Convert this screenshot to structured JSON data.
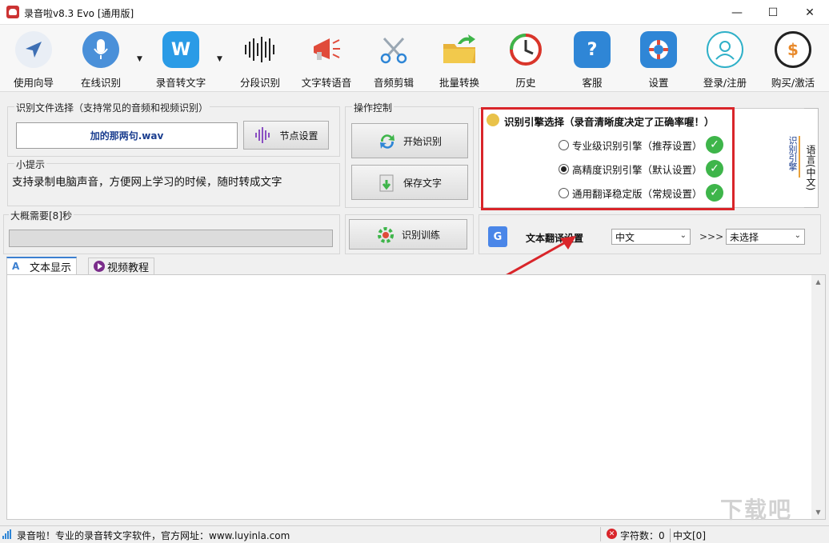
{
  "window": {
    "title": "录音啦v8.3 Evo [通用版]",
    "minimize": "—",
    "maximize": "☐",
    "close": "✕"
  },
  "toolbar": {
    "items": [
      {
        "label": "使用向导",
        "icon": "navigate-icon",
        "color": "#3d6fb4"
      },
      {
        "label": "在线识别",
        "icon": "microphone-icon",
        "color": "#4a90d9"
      },
      {
        "label": "录音转文字",
        "icon": "w-app-icon",
        "color": "#2a9be6"
      },
      {
        "label": "分段识别",
        "icon": "waveform-icon",
        "color": "#222222"
      },
      {
        "label": "文字转语音",
        "icon": "megaphone-icon",
        "color": "#e04b3a"
      },
      {
        "label": "音频剪辑",
        "icon": "scissors-icon",
        "color": "#9aa7b3"
      },
      {
        "label": "批量转换",
        "icon": "folder-icon",
        "color": "#e8b33a"
      },
      {
        "label": "历史",
        "icon": "clock-icon",
        "color": "#d9352a"
      },
      {
        "label": "客服",
        "icon": "help-icon",
        "color": "#2f86d6"
      },
      {
        "label": "设置",
        "icon": "lifebuoy-icon",
        "color": "#2f86d6"
      },
      {
        "label": "登录/注册",
        "icon": "user-icon",
        "color": "#2fb0c8"
      },
      {
        "label": "购买/激活",
        "icon": "coin-icon",
        "color": "#222222"
      }
    ]
  },
  "file_section": {
    "title": "识别文件选择（支持常见的音频和视频识别）",
    "file_name": "加的那两句.wav",
    "node_button": "节点设置"
  },
  "tip_section": {
    "title": "小提示",
    "text": "支持录制电脑声音，方便网上学习的时候，随时转成文字"
  },
  "progress_section": {
    "title": "大概需要[8]秒",
    "value": 0
  },
  "control_section": {
    "title": "操作控制",
    "start_button": "开始识别",
    "save_button": "保存文字",
    "train_button": "识别训练"
  },
  "engine_section": {
    "title": "识别引擎选择（录音清晰度决定了正确率喔！）",
    "options": [
      {
        "label": "专业级识别引擎（推荐设置）",
        "selected": false
      },
      {
        "label": "高精度识别引擎（默认设置）",
        "selected": true
      },
      {
        "label": "通用翻译稳定版（常规设置）",
        "selected": false
      }
    ],
    "side_tab_engine": "识别引擎",
    "side_tab_lang": "语言(中文)"
  },
  "translate_section": {
    "label": "文本翻译设置",
    "source_lang": "中文",
    "arrows": ">>>",
    "target_lang": "未选择"
  },
  "tabs": [
    {
      "label": "文本显示",
      "active": true
    },
    {
      "label": "视频教程",
      "active": false
    }
  ],
  "statusbar": {
    "text": "录音啦！专业的录音转文字软件，官方网址：www.luyinla.com",
    "char_count": "字符数：0",
    "lang": "中文[0]"
  },
  "watermark": "下载吧"
}
